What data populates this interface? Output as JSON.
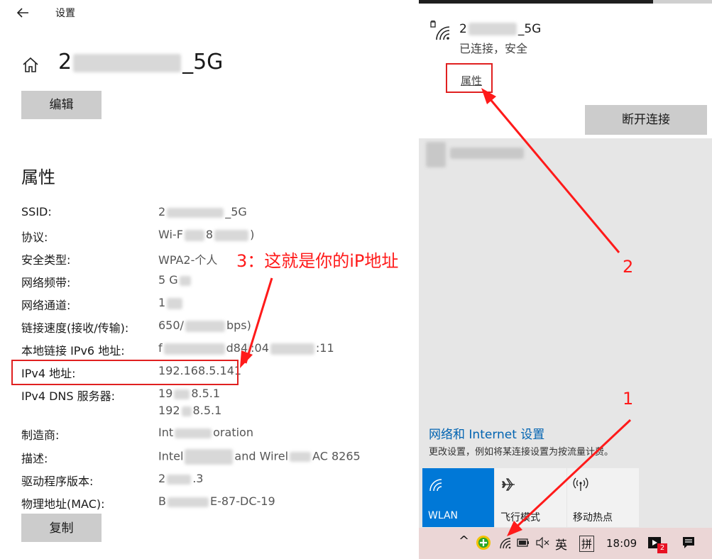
{
  "settings": {
    "app_title": "设置",
    "network_name_start": "2",
    "network_name_end": "_5G",
    "edit_label": "编辑",
    "section_title": "属性",
    "copy_label": "复制",
    "properties": [
      {
        "label": "SSID:",
        "value_visible": "2_5G"
      },
      {
        "label": "协议:",
        "value_visible": "Wi-F 8 )"
      },
      {
        "label": "安全类型:",
        "value_visible": "WPA2-个人"
      },
      {
        "label": "网络频带:",
        "value_visible": "5 G"
      },
      {
        "label": "网络通道:",
        "value_visible": "1"
      },
      {
        "label": "链接速度(接收/传输):",
        "value_visible": "650/ bps)"
      },
      {
        "label": "本地链接 IPv6 地址:",
        "value_visible": "f d84 :04 :11"
      },
      {
        "label": "IPv4 地址:",
        "value_visible": "192.168.5.141"
      },
      {
        "label": "IPv4 DNS 服务器:",
        "value_visible": "19 8.5.1",
        "value_visible_2": "192 8.5.1"
      },
      {
        "label": "制造商:",
        "value_visible": "Int oration"
      },
      {
        "label": "描述:",
        "value_visible": "Intel and Wirel AC 8265"
      },
      {
        "label": "驱动程序版本:",
        "value_visible": "2 .3"
      },
      {
        "label": "物理地址(MAC):",
        "value_visible": "B E-87-DC-19"
      }
    ]
  },
  "annotations": {
    "step3": "3：这就是你的iP地址",
    "step2": "2",
    "step1": "1",
    "color": "#ff1a1a"
  },
  "flyout": {
    "ssid_start": "2",
    "ssid_end": "_5G",
    "status": "已连接，安全",
    "properties_link": "属性",
    "disconnect_label": "断开连接",
    "net_settings_title": "网络和 Internet 设置",
    "net_settings_sub": "更改设置，例如将某连接设置为按流量计费。",
    "tiles": [
      {
        "label": "WLAN",
        "icon": "wifi-icon",
        "active": true
      },
      {
        "label": "飞行模式",
        "icon": "airplane-icon",
        "active": false
      },
      {
        "label": "移动热点",
        "icon": "hotspot-icon",
        "active": false
      }
    ],
    "accent_color": "#0078d7"
  },
  "taskbar": {
    "chevron": "^",
    "ime_lang": "英",
    "ime_mode": "拼",
    "time": "18:09",
    "notification_badge": "2"
  }
}
